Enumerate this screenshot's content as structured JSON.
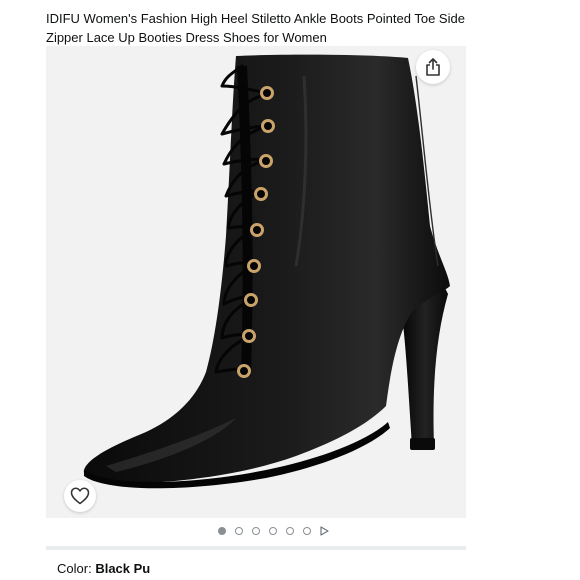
{
  "product": {
    "title": "IDIFU Women's Fashion High Heel Stiletto Ankle Boots Pointed Toe Side Zipper Lace Up Booties Dress Shoes for Women"
  },
  "gallery": {
    "image_alt": "Black Pu pointed toe lace-up stiletto ankle boot",
    "share_icon": "share-icon",
    "wishlist_icon": "heart-icon",
    "image_count": 6,
    "active_image": 1,
    "has_video": true
  },
  "variation": {
    "color_label": "Color:",
    "color_value": "Black Pu"
  },
  "colors": {
    "title_text": "#0f1111",
    "image_bg": "#f2f2f2",
    "boot_leather": "#141414",
    "eyelet": "#c9a36a",
    "pager_dot": "#8a8f94",
    "divider": "#eaeded"
  }
}
